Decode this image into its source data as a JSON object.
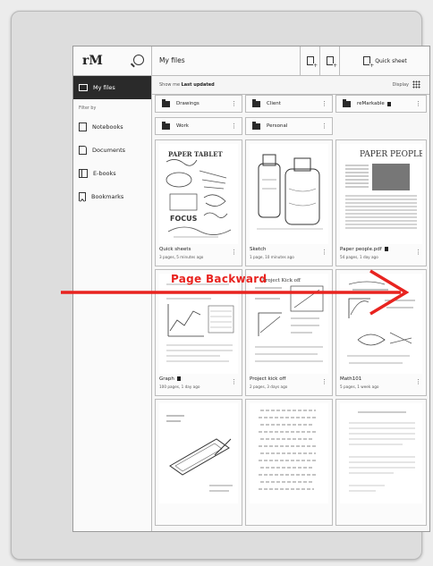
{
  "sidebar": {
    "logo": "rM",
    "active_item": "My files",
    "filter_label": "Filter by",
    "items": [
      {
        "label": "Notebooks",
        "icon": "notebook-icon"
      },
      {
        "label": "Documents",
        "icon": "document-icon"
      },
      {
        "label": "E-books",
        "icon": "ebook-icon"
      },
      {
        "label": "Bookmarks",
        "icon": "bookmark-icon"
      }
    ]
  },
  "header": {
    "title": "My files",
    "quick_sheet_label": "Quick sheet"
  },
  "sortbar": {
    "prefix": "Show me",
    "sort_value": "Last updated",
    "display_label": "Display"
  },
  "folders": [
    {
      "name": "Drawings",
      "bookmarked": false
    },
    {
      "name": "Client",
      "bookmarked": false
    },
    {
      "name": "reMarkable",
      "bookmarked": true
    },
    {
      "name": "Work",
      "bookmarked": false
    },
    {
      "name": "Personal",
      "bookmarked": false
    }
  ],
  "documents": [
    {
      "name": "Quick sheets",
      "meta": "3 pages, 5 minutes ago",
      "bookmarked": false
    },
    {
      "name": "Sketch",
      "meta": "1 page, 10 minutes ago",
      "bookmarked": false
    },
    {
      "name": "Paper people.pdf",
      "meta": "54 pages, 1 day ago",
      "bookmarked": true
    },
    {
      "name": "Graph",
      "meta": "100 pages, 1 day ago",
      "bookmarked": true
    },
    {
      "name": "Project kick off",
      "meta": "2 pages, 3 days ago",
      "bookmarked": false
    },
    {
      "name": "Math101",
      "meta": "5 pages, 1 week ago",
      "bookmarked": false
    },
    {
      "name": "",
      "meta": "",
      "bookmarked": false
    },
    {
      "name": "",
      "meta": "",
      "bookmarked": false
    },
    {
      "name": "",
      "meta": "",
      "bookmarked": false
    }
  ],
  "thumb_text": {
    "quick_sheets": "PAPER TABLET",
    "paper_people": "PAPER PEOPLE",
    "project": "Project Kick off"
  },
  "annotation": {
    "label": "Page Backward",
    "color": "#e8231f"
  }
}
